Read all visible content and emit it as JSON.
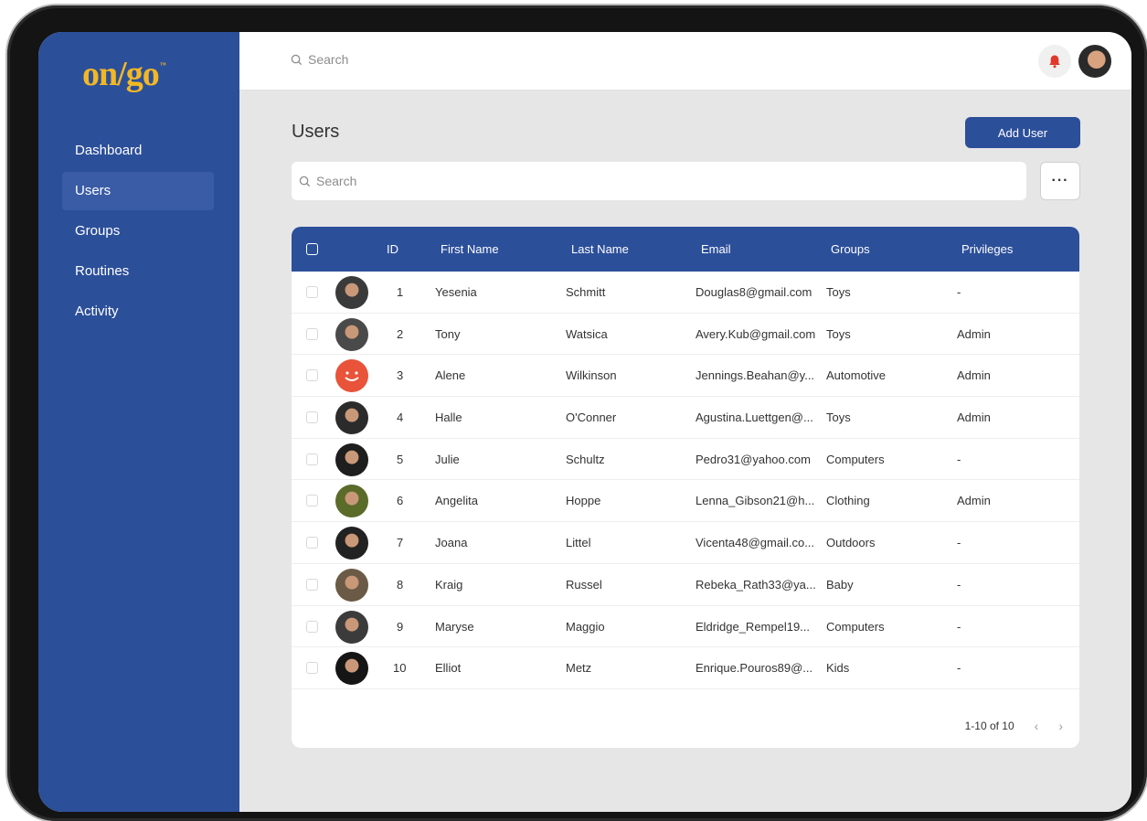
{
  "brand": {
    "logo": "on/go",
    "tm": "™",
    "logo_color": "#f2b824",
    "primary": "#2c4f9a"
  },
  "sidebar": {
    "items": [
      {
        "label": "Dashboard",
        "active": false
      },
      {
        "label": "Users",
        "active": true
      },
      {
        "label": "Groups",
        "active": false
      },
      {
        "label": "Routines",
        "active": false
      },
      {
        "label": "Activity",
        "active": false
      }
    ]
  },
  "topbar": {
    "search_placeholder": "Search",
    "bell_icon": "bell-icon",
    "avatar": "user-avatar"
  },
  "page": {
    "title": "Users",
    "add_button": "Add User",
    "search_placeholder": "Search",
    "more_label": "···"
  },
  "table": {
    "headers": {
      "id": "ID",
      "first": "First Name",
      "last": "Last Name",
      "email": "Email",
      "groups": "Groups",
      "privileges": "Privileges"
    },
    "rows": [
      {
        "id": "1",
        "first": "Yesenia",
        "last": "Schmitt",
        "email": "Douglas8@gmail.com",
        "group": "Toys",
        "priv": "-"
      },
      {
        "id": "2",
        "first": "Tony",
        "last": "Watsica",
        "email": "Avery.Kub@gmail.com",
        "group": "Toys",
        "priv": "Admin"
      },
      {
        "id": "3",
        "first": "Alene",
        "last": "Wilkinson",
        "email": "Jennings.Beahan@y...",
        "group": "Automotive",
        "priv": "Admin"
      },
      {
        "id": "4",
        "first": "Halle",
        "last": "O'Conner",
        "email": "Agustina.Luettgen@...",
        "group": "Toys",
        "priv": "Admin"
      },
      {
        "id": "5",
        "first": "Julie",
        "last": "Schultz",
        "email": "Pedro31@yahoo.com",
        "group": "Computers",
        "priv": "-"
      },
      {
        "id": "6",
        "first": "Angelita",
        "last": "Hoppe",
        "email": "Lenna_Gibson21@h...",
        "group": "Clothing",
        "priv": "Admin"
      },
      {
        "id": "7",
        "first": "Joana",
        "last": "Littel",
        "email": "Vicenta48@gmail.co...",
        "group": "Outdoors",
        "priv": "-"
      },
      {
        "id": "8",
        "first": "Kraig",
        "last": "Russel",
        "email": "Rebeka_Rath33@ya...",
        "group": "Baby",
        "priv": "-"
      },
      {
        "id": "9",
        "first": "Maryse",
        "last": "Maggio",
        "email": "Eldridge_Rempel19...",
        "group": "Computers",
        "priv": "-"
      },
      {
        "id": "10",
        "first": "Elliot",
        "last": "Metz",
        "email": "Enrique.Pouros89@...",
        "group": "Kids",
        "priv": "-"
      }
    ],
    "avatar_colors": [
      "#3a3a3a",
      "#4a4a4a",
      "#e8533a",
      "#2b2b2b",
      "#1e1e1e",
      "#5a6b2a",
      "#222222",
      "#6b5a45",
      "#3b3b3b",
      "#151515"
    ]
  },
  "pagination": {
    "label": "1-10 of 10",
    "prev": "‹",
    "next": "›"
  }
}
